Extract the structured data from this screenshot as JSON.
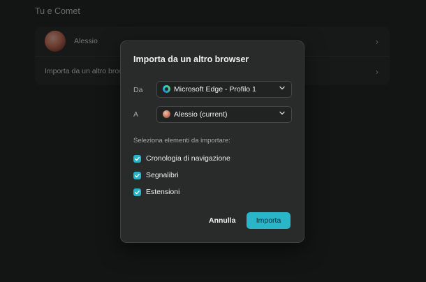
{
  "background": {
    "section_title": "Tu e Comet",
    "profile_name": "Alessio",
    "import_row_label": "Importa da un altro browser"
  },
  "dialog": {
    "title": "Importa da un altro browser",
    "from_label": "Da",
    "from_value": "Microsoft Edge - Profilo 1",
    "to_label": "A",
    "to_value": "Alessio (current)",
    "items_caption": "Seleziona elementi da importare:",
    "items": [
      {
        "label": "Cronologia di navigazione",
        "checked": true
      },
      {
        "label": "Segnalibri",
        "checked": true
      },
      {
        "label": "Estensioni",
        "checked": true
      }
    ],
    "cancel_label": "Annulla",
    "import_label": "Importa"
  },
  "colors": {
    "accent": "#29b6c8",
    "dialog_bg": "#282b2a",
    "page_bg": "#151716"
  },
  "icons": {
    "from_browser": "edge-icon",
    "to_profile": "avatar",
    "select_arrow": "chevron-down-icon",
    "row_arrow": "chevron-right-icon"
  }
}
